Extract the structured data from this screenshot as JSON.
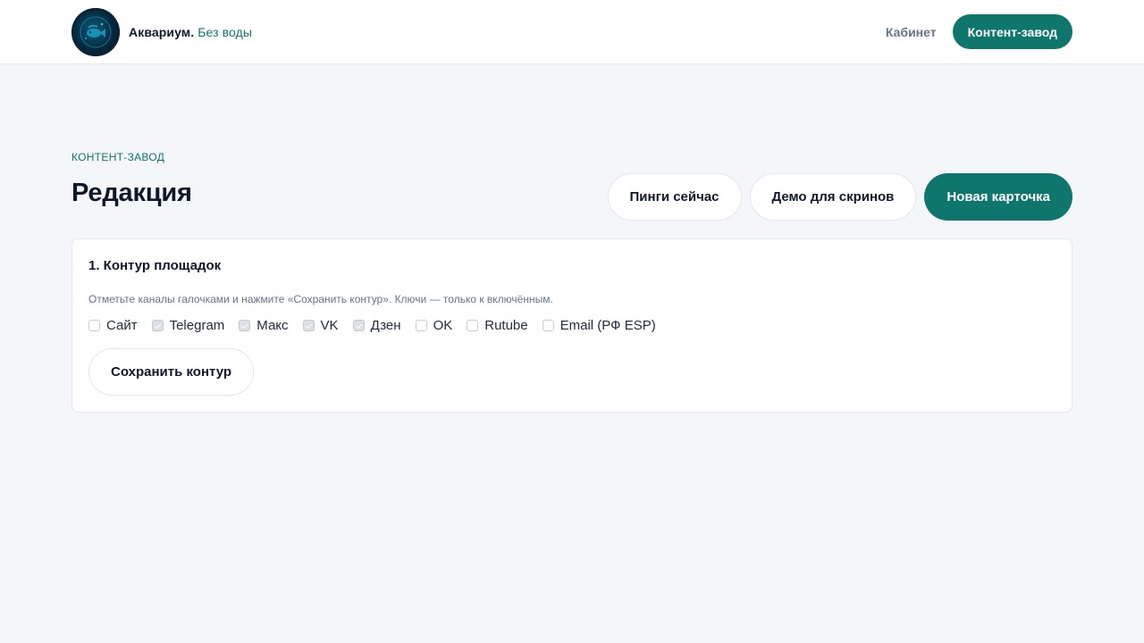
{
  "header": {
    "brand_name": "Аквариум.",
    "brand_tagline": "Без воды",
    "logo_icon": "fish-globe-icon",
    "nav_cabinet": "Кабинет",
    "nav_content_factory": "Контент-завод"
  },
  "page": {
    "eyebrow": "КОНТЕНТ-ЗАВОД",
    "title": "Редакция",
    "actions": {
      "pings_now": "Пинги сейчас",
      "demo_screens": "Демо для скринов",
      "new_card": "Новая карточка"
    }
  },
  "card": {
    "title": "1. Контур площадок",
    "hint": "Отметьте каналы галочками и нажмите «Сохранить контур». Ключи — только к включённым.",
    "channels": [
      {
        "label": "Сайт",
        "checked": false
      },
      {
        "label": "Telegram",
        "checked": true
      },
      {
        "label": "Макс",
        "checked": true
      },
      {
        "label": "VK",
        "checked": true
      },
      {
        "label": "Дзен",
        "checked": true
      },
      {
        "label": "OK",
        "checked": false
      },
      {
        "label": "Rutube",
        "checked": false
      },
      {
        "label": "Email (РФ ESP)",
        "checked": false
      }
    ],
    "save_label": "Сохранить контур"
  },
  "colors": {
    "accent": "#0f766e",
    "background": "#f4f6f9",
    "text": "#0f172a",
    "muted": "#64748b"
  }
}
